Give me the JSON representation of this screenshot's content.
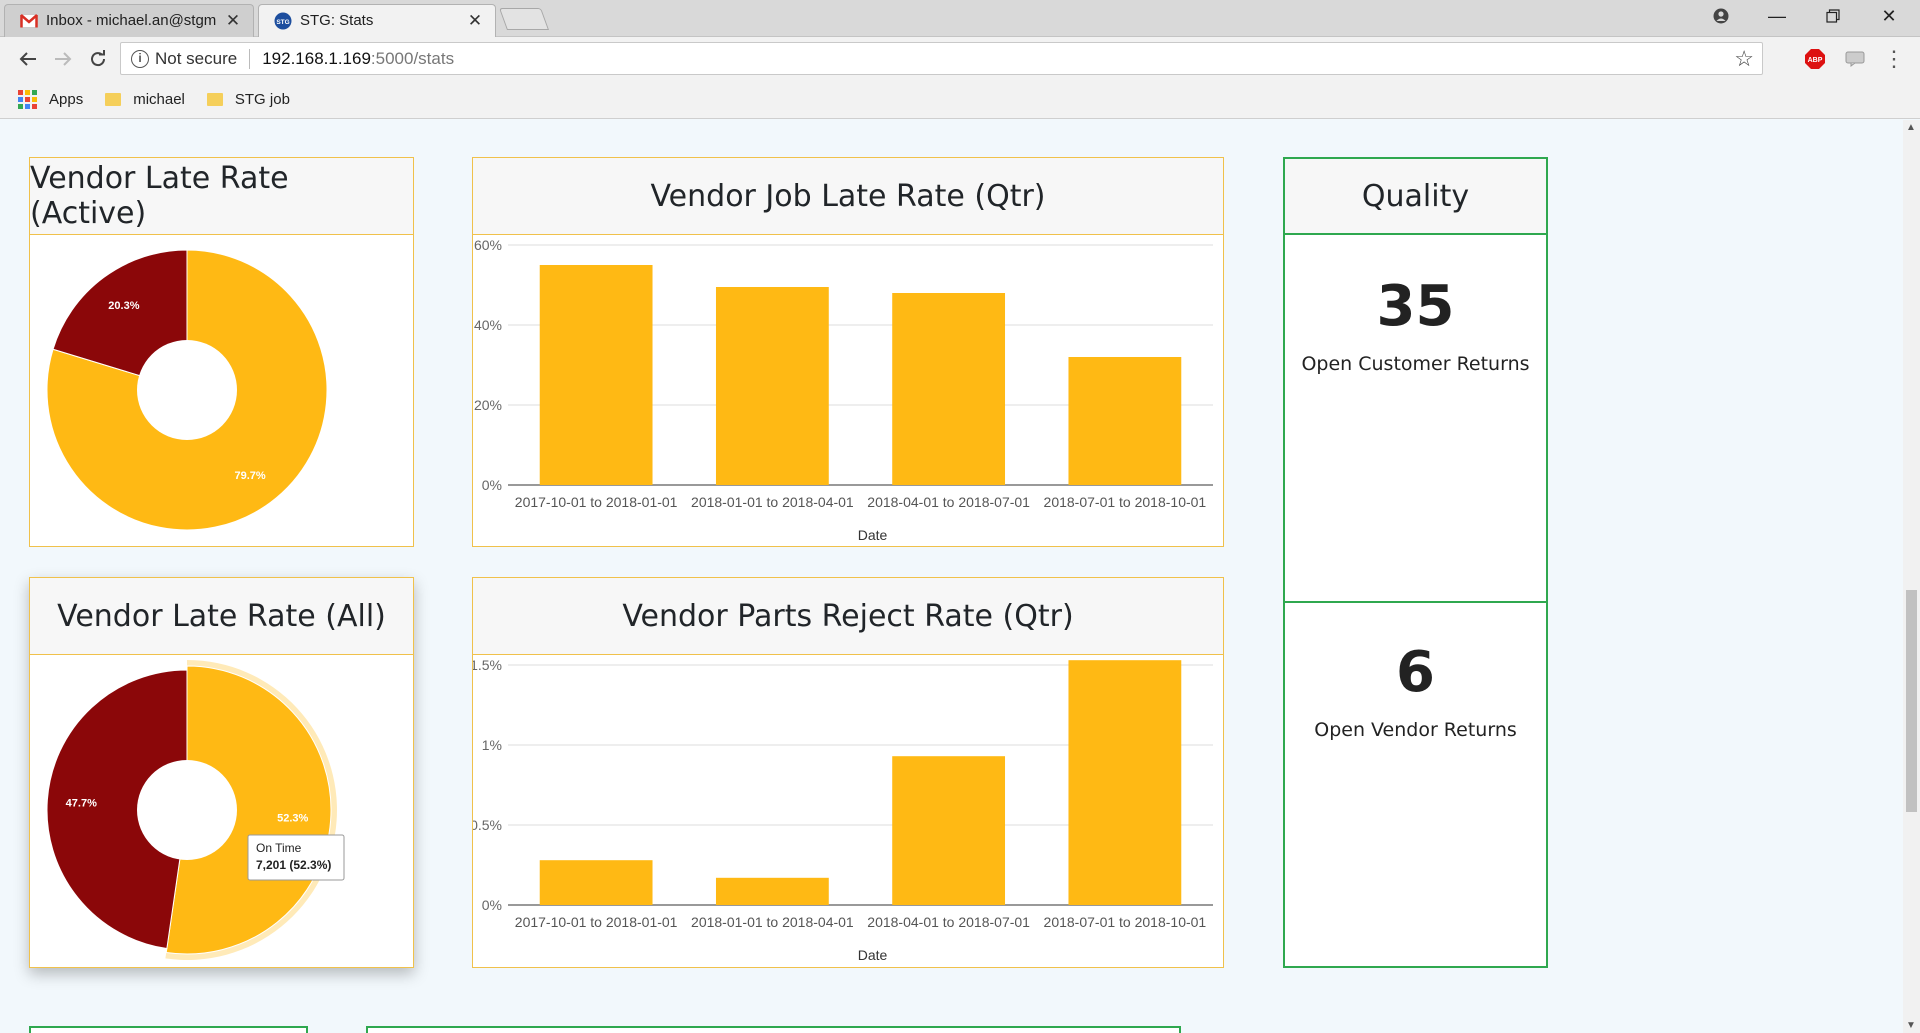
{
  "browser": {
    "tabs": [
      {
        "title": "Inbox - michael.an@stgm",
        "icon": "gmail-icon",
        "active": false
      },
      {
        "title": "STG: Stats",
        "icon": "stg-icon",
        "active": true
      }
    ],
    "address": {
      "security_label": "Not secure",
      "host": "192.168.1.169",
      "path": ":5000/stats"
    },
    "bookmarks": [
      {
        "label": "Apps",
        "icon": "apps-grid-icon"
      },
      {
        "label": "michael",
        "icon": "folder-icon"
      },
      {
        "label": "STG job",
        "icon": "folder-icon"
      }
    ]
  },
  "colors": {
    "accent": "#ffb914",
    "late": "#8b0709",
    "card_border": "#f0c14b",
    "quality_border": "#2fa84f"
  },
  "cards": {
    "late_active_title": "Vendor Late Rate (Active)",
    "late_all_title": "Vendor Late Rate (All)",
    "job_late_title": "Vendor Job Late Rate (Qtr)",
    "parts_reject_title": "Vendor Parts Reject Rate (Qtr)",
    "quality_title": "Quality"
  },
  "quality": {
    "customer_returns_value": "35",
    "customer_returns_label": "Open Customer Returns",
    "vendor_returns_value": "6",
    "vendor_returns_label": "Open Vendor Returns"
  },
  "tooltip": {
    "label": "On Time",
    "value": "7,201 (52.3%)"
  },
  "chart_data": [
    {
      "type": "pie",
      "title": "Vendor Late Rate (Active)",
      "slices": [
        {
          "label": "",
          "value": 79.7,
          "display": "79.7%",
          "color": "#ffb914"
        },
        {
          "label": "",
          "value": 20.3,
          "display": "20.3%",
          "color": "#8b0709"
        }
      ],
      "donut": true
    },
    {
      "type": "pie",
      "title": "Vendor Late Rate (All)",
      "slices": [
        {
          "label": "On Time",
          "value": 52.3,
          "display": "52.3%",
          "color": "#ffb914"
        },
        {
          "label": "",
          "value": 47.7,
          "display": "47.7%",
          "color": "#8b0709"
        }
      ],
      "donut": true
    },
    {
      "type": "bar",
      "title": "Vendor Job Late Rate (Qtr)",
      "categories": [
        "2017-10-01 to 2018-01-01",
        "2018-01-01 to 2018-04-01",
        "2018-04-01 to 2018-07-01",
        "2018-07-01 to 2018-10-01"
      ],
      "values": [
        55,
        49.5,
        48,
        32
      ],
      "xlabel": "Date",
      "ylabel": "",
      "ylim": [
        0,
        60
      ],
      "yticks": [
        0,
        20,
        40,
        60
      ],
      "ytick_labels": [
        "0%",
        "20%",
        "40%",
        "60%"
      ],
      "grid": true
    },
    {
      "type": "bar",
      "title": "Vendor Parts Reject Rate (Qtr)",
      "categories": [
        "2017-10-01 to 2018-01-01",
        "2018-01-01 to 2018-04-01",
        "2018-04-01 to 2018-07-01",
        "2018-07-01 to 2018-10-01"
      ],
      "values": [
        0.28,
        0.17,
        0.93,
        1.53
      ],
      "xlabel": "Date",
      "ylabel": "",
      "ylim": [
        0,
        1.5
      ],
      "yticks": [
        0,
        0.5,
        1,
        1.5
      ],
      "ytick_labels": [
        "0%",
        "0.5%",
        "1%",
        "1.5%"
      ],
      "grid": true
    }
  ]
}
